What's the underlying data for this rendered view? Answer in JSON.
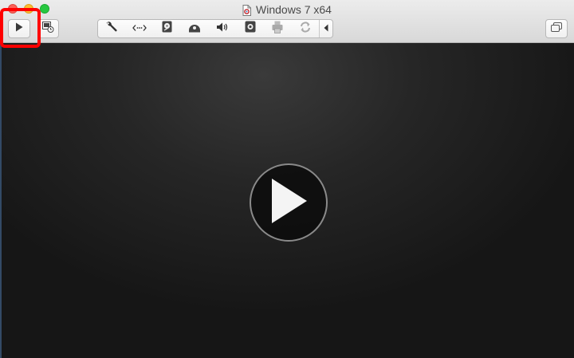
{
  "window": {
    "title": "Windows 7 x64"
  },
  "toolbar": {
    "left_buttons": [
      {
        "name": "play-icon"
      },
      {
        "name": "snapshot-icon"
      }
    ],
    "segment_icons": [
      "wrench-icon",
      "network-arrows-icon",
      "hard-disk-icon",
      "optical-disc-icon",
      "speaker-icon",
      "camera-icon",
      "printer-icon",
      "sync-icon",
      "chevron-left-icon"
    ],
    "right_buttons": [
      {
        "name": "restore-window-icon"
      }
    ]
  },
  "colors": {
    "highlight": "#ff0000",
    "close": "#fc5f57",
    "minimize": "#fdbc2e",
    "maximize": "#27c840"
  }
}
